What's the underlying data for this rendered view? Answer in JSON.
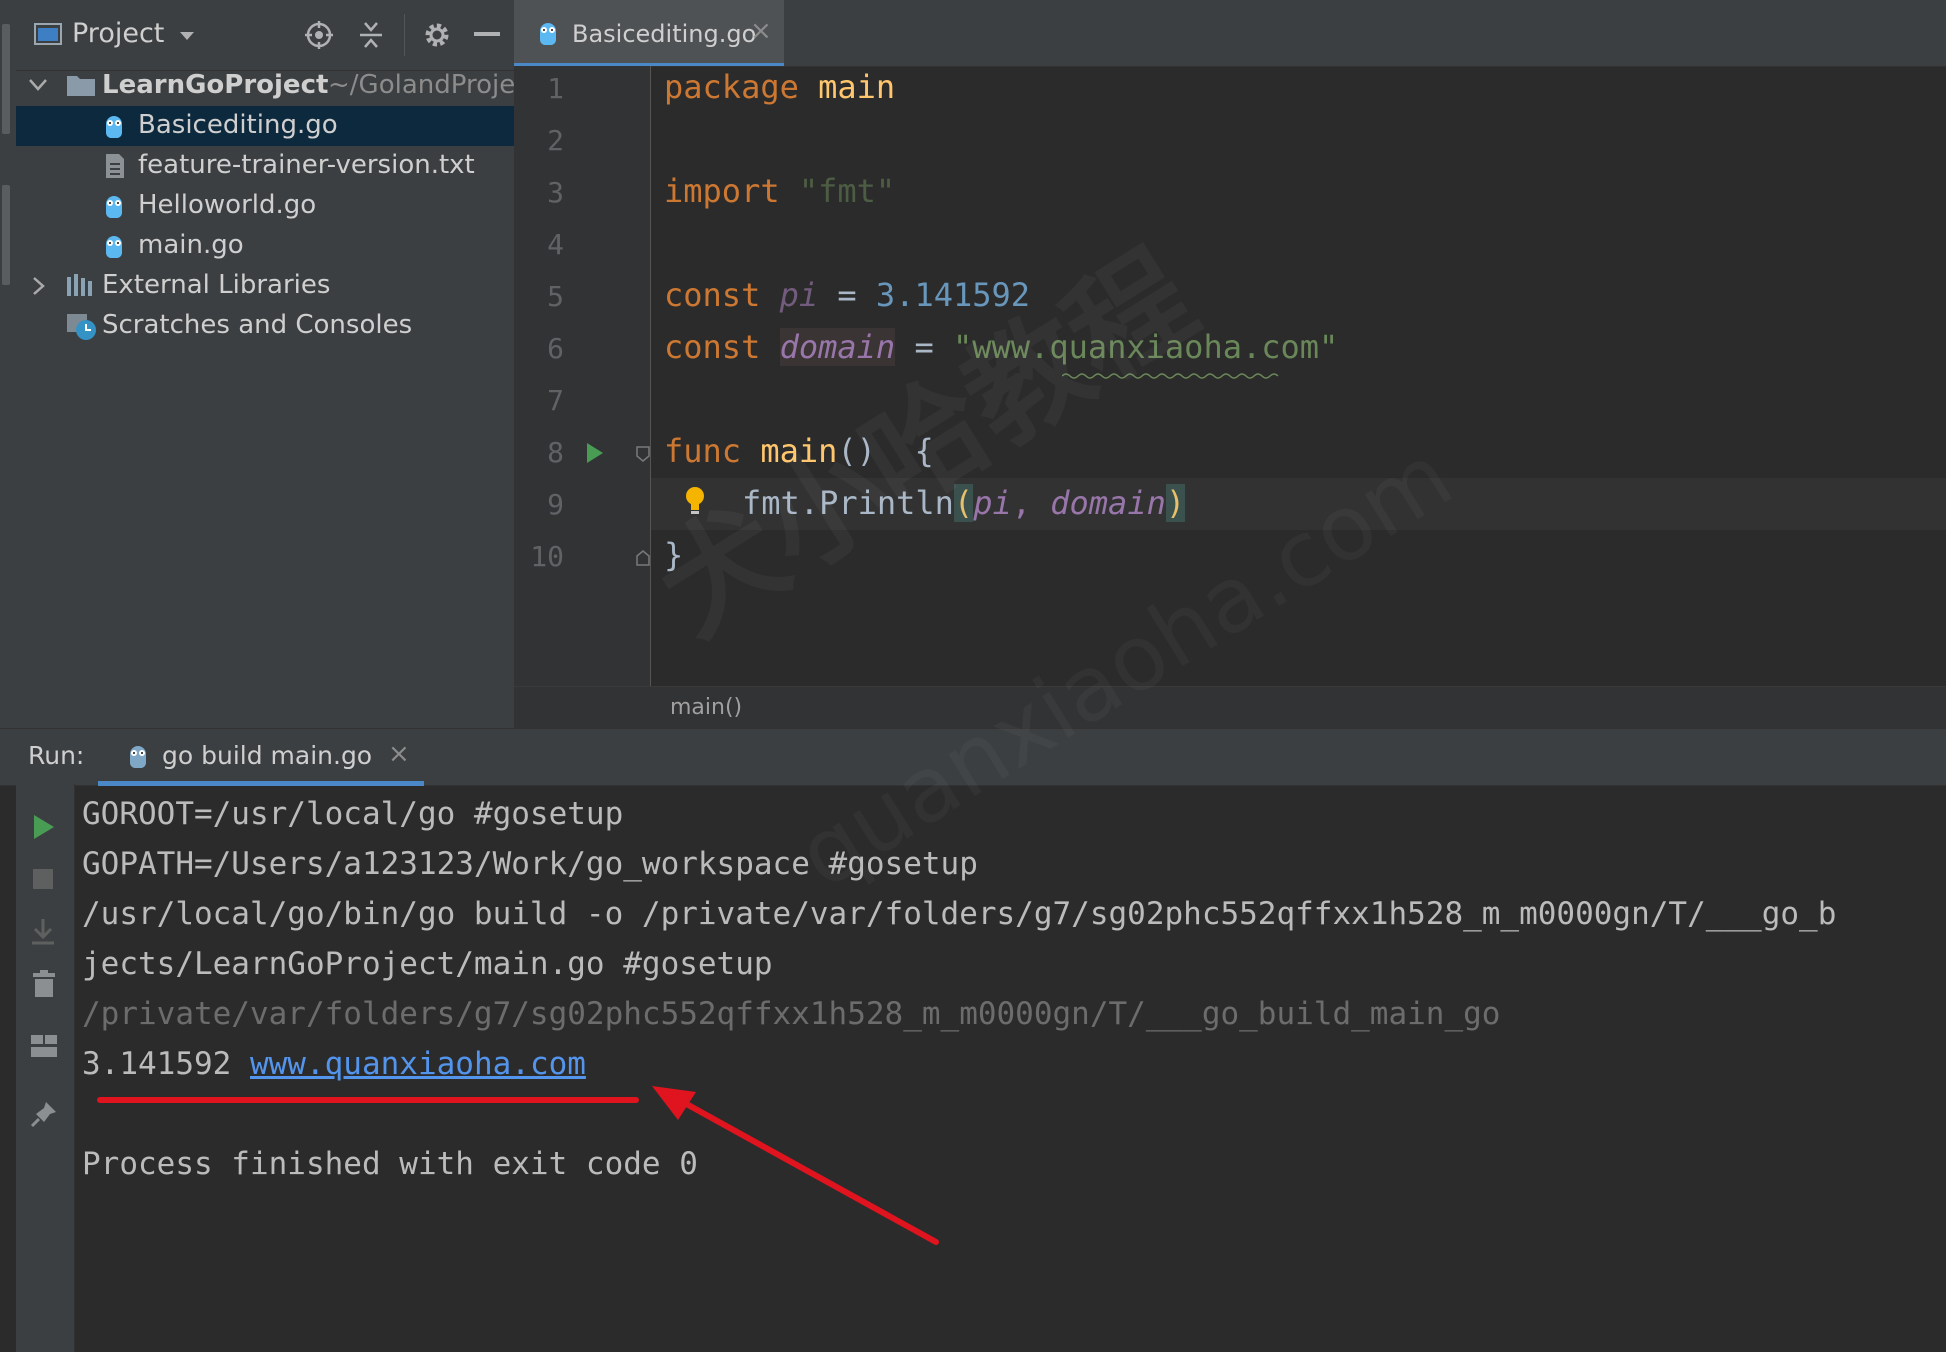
{
  "project_panel": {
    "title": "Project",
    "tree": [
      {
        "label": "LearnGoProject",
        "hint": "~/GolandProjec",
        "icon": "folder-icon",
        "expanded": true
      },
      {
        "label": "Basicediting.go",
        "icon": "go-file-icon",
        "selected": true
      },
      {
        "label": "feature-trainer-version.txt",
        "icon": "text-file-icon"
      },
      {
        "label": "Helloworld.go",
        "icon": "go-file-icon"
      },
      {
        "label": "main.go",
        "icon": "go-file-icon"
      },
      {
        "label": "External Libraries",
        "icon": "library-icon"
      },
      {
        "label": "Scratches and Consoles",
        "icon": "scratches-icon"
      }
    ]
  },
  "editor": {
    "tab": {
      "label": "Basicediting.go",
      "close": "×"
    },
    "line_numbers": [
      "1",
      "2",
      "3",
      "4",
      "5",
      "6",
      "7",
      "8",
      "9",
      "10"
    ],
    "code": {
      "l1_kw": "package",
      "l1_name": "main",
      "l3_kw": "import",
      "l3_str": "\"fmt\"",
      "l5_kw": "const",
      "l5_name": "pi",
      "l5_eq": "=",
      "l5_num": "3.141592",
      "l6_kw": "const",
      "l6_name": "domain",
      "l6_eq": "=",
      "l6_str": "\"www.quanxiaoha.com\"",
      "l8_kw": "func",
      "l8_fn": "main",
      "l8_rest": "()  {",
      "l9_pkg": "fmt.",
      "l9_fn": "Println",
      "l9_open": "(",
      "l9_a1": "pi",
      "l9_comma": ", ",
      "l9_a2": "domain",
      "l9_close": ")",
      "l10": "}"
    },
    "breadcrumb": "main()"
  },
  "run_panel": {
    "label": "Run:",
    "tab": {
      "label": "go build main.go",
      "close": "×"
    },
    "output": {
      "line1": "GOROOT=/usr/local/go #gosetup",
      "line2": "GOPATH=/Users/a123123/Work/go_workspace #gosetup",
      "line3": "/usr/local/go/bin/go build -o /private/var/folders/g7/sg02phc552qffxx1h528_m_m0000gn/T/___go_b",
      "line4": "jects/LearnGoProject/main.go #gosetup",
      "line5": "/private/var/folders/g7/sg02phc552qffxx1h528_m_m0000gn/T/___go_build_main_go",
      "line6_value": "3.141592",
      "line6_link": "www.quanxiaoha.com",
      "line7": "Process finished with exit code 0"
    }
  },
  "watermark": {
    "text1": "犬小哈教程",
    "text2": "quanxiaoha.com"
  },
  "colors": {
    "annotation_red": "#e0141e",
    "accent_blue": "#4a88c7",
    "keyword": "#cc7832",
    "string": "#6a8759",
    "number": "#6897bb",
    "constant": "#9876aa",
    "function": "#ffc66d"
  }
}
